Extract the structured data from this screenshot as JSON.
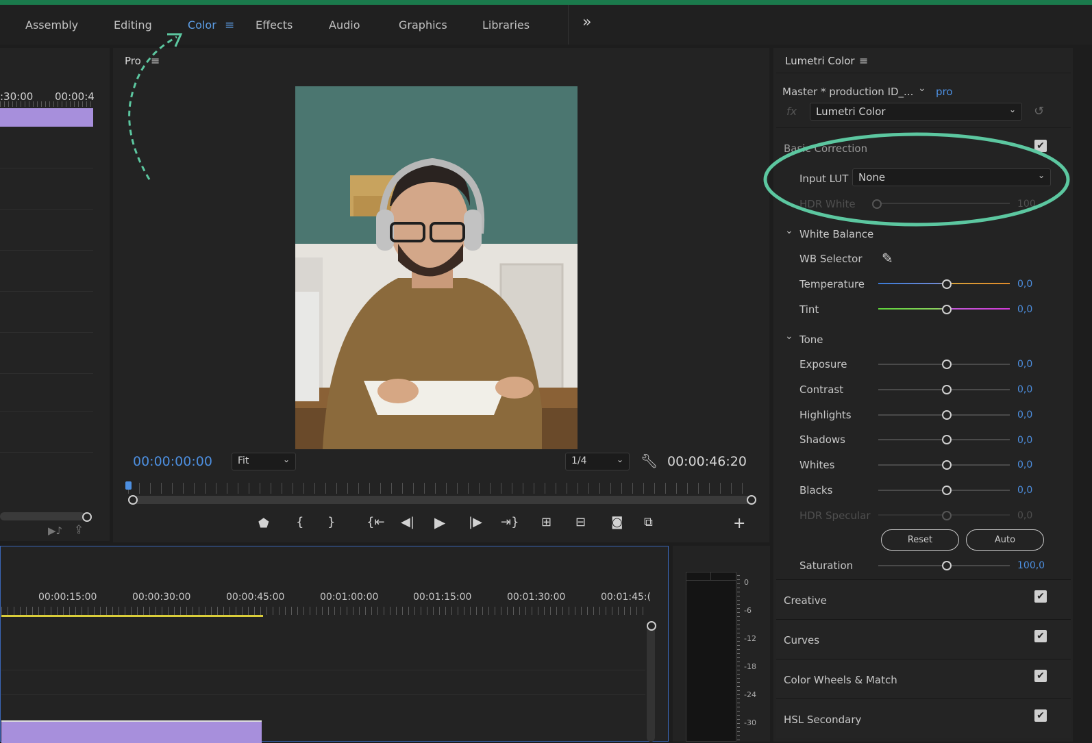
{
  "workspaces": {
    "tabs": [
      {
        "label": "Assembly"
      },
      {
        "label": "Editing"
      },
      {
        "label": "Color"
      },
      {
        "label": "Effects"
      },
      {
        "label": "Audio"
      },
      {
        "label": "Graphics"
      },
      {
        "label": "Libraries"
      }
    ],
    "active": "Color",
    "more_glyph": "»"
  },
  "source_panel": {
    "ruler_labels": [
      ":30:00",
      "00:00:4"
    ]
  },
  "program_monitor": {
    "title": "Pro",
    "current_timecode": "00:00:00:00",
    "zoom_select": "Fit",
    "resolution_select": "1/4",
    "duration_timecode": "00:00:46:20",
    "frame_description": "man with headphones writing in a notebook"
  },
  "lumetri": {
    "panel_title": "Lumetri Color",
    "master_label": "Master * production ID_...",
    "clip_link": "pro",
    "effect_select": "Lumetri Color",
    "basic_correction": "Basic Correction",
    "input_lut_label": "Input LUT",
    "input_lut_value": "None",
    "hdr_white_label": "HDR White",
    "hdr_white_value": "100",
    "white_balance": {
      "header": "White Balance",
      "wb_selector": "WB Selector",
      "temperature": {
        "label": "Temperature",
        "value": "0,0"
      },
      "tint": {
        "label": "Tint",
        "value": "0,0"
      }
    },
    "tone": {
      "header": "Tone",
      "sliders": [
        {
          "label": "Exposure",
          "value": "0,0"
        },
        {
          "label": "Contrast",
          "value": "0,0"
        },
        {
          "label": "Highlights",
          "value": "0,0"
        },
        {
          "label": "Shadows",
          "value": "0,0"
        },
        {
          "label": "Whites",
          "value": "0,0"
        },
        {
          "label": "Blacks",
          "value": "0,0"
        },
        {
          "label": "HDR Specular",
          "value": "0,0"
        }
      ],
      "reset_label": "Reset",
      "auto_label": "Auto",
      "saturation": {
        "label": "Saturation",
        "value": "100,0"
      }
    },
    "sections": [
      {
        "label": "Creative"
      },
      {
        "label": "Curves"
      },
      {
        "label": "Color Wheels & Match"
      },
      {
        "label": "HSL Secondary"
      }
    ]
  },
  "timeline": {
    "ruler_labels": [
      "00:00:15:00",
      "00:00:30:00",
      "00:00:45:00",
      "00:01:00:00",
      "00:01:15:00",
      "00:01:30:00",
      "00:01:45:("
    ]
  },
  "audio_meter": {
    "scale": [
      "0",
      "-6",
      "-12",
      "-18",
      "-24",
      "-30"
    ]
  },
  "colors": {
    "accent_blue": "#4d8fe0",
    "annotation_green": "#5cc7a0",
    "clip_purple": "#a78fdc",
    "work_area_yellow": "#d9cd3a",
    "top_strip_green": "#1b7a4c"
  }
}
